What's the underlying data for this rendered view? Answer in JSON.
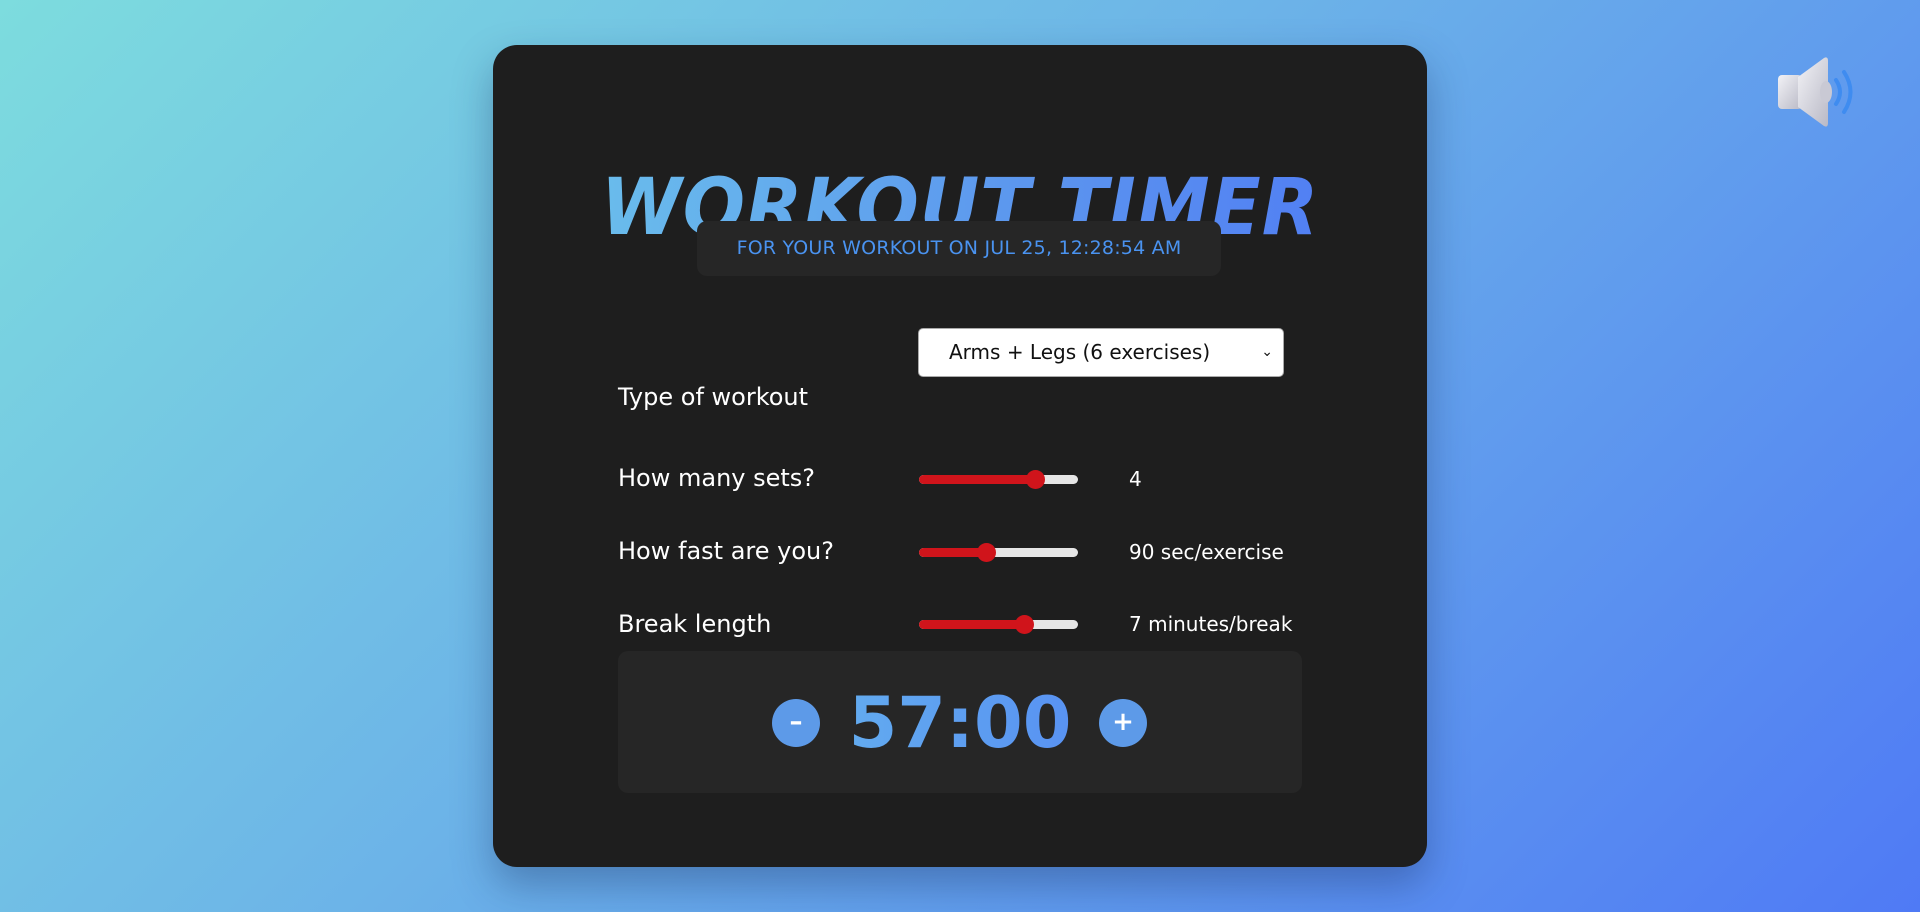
{
  "app": {
    "title": "WORKOUT TIMER",
    "subtitle": "FOR YOUR WORKOUT ON JUL 25, 12:28:54 AM"
  },
  "settings": {
    "workout_type": {
      "label": "Type of workout",
      "selected": "Arms + Legs (6 exercises)"
    },
    "sets": {
      "label": "How many sets?",
      "value_text": "4",
      "slider_fraction": 0.73
    },
    "speed": {
      "label": "How fast are you?",
      "value_text": "90 sec/exercise",
      "slider_fraction": 0.42
    },
    "break_length": {
      "label": "Break length",
      "value_text": "7 minutes/break",
      "slider_fraction": 0.66
    }
  },
  "timer": {
    "time": "57:00",
    "decrement_label": "–",
    "increment_label": "+"
  },
  "icons": {
    "speaker": "speaker-volume-icon"
  },
  "colors": {
    "accent_blue": "#5b94ee",
    "slider_red": "#d0141b",
    "card_bg": "#1e1e1e"
  }
}
